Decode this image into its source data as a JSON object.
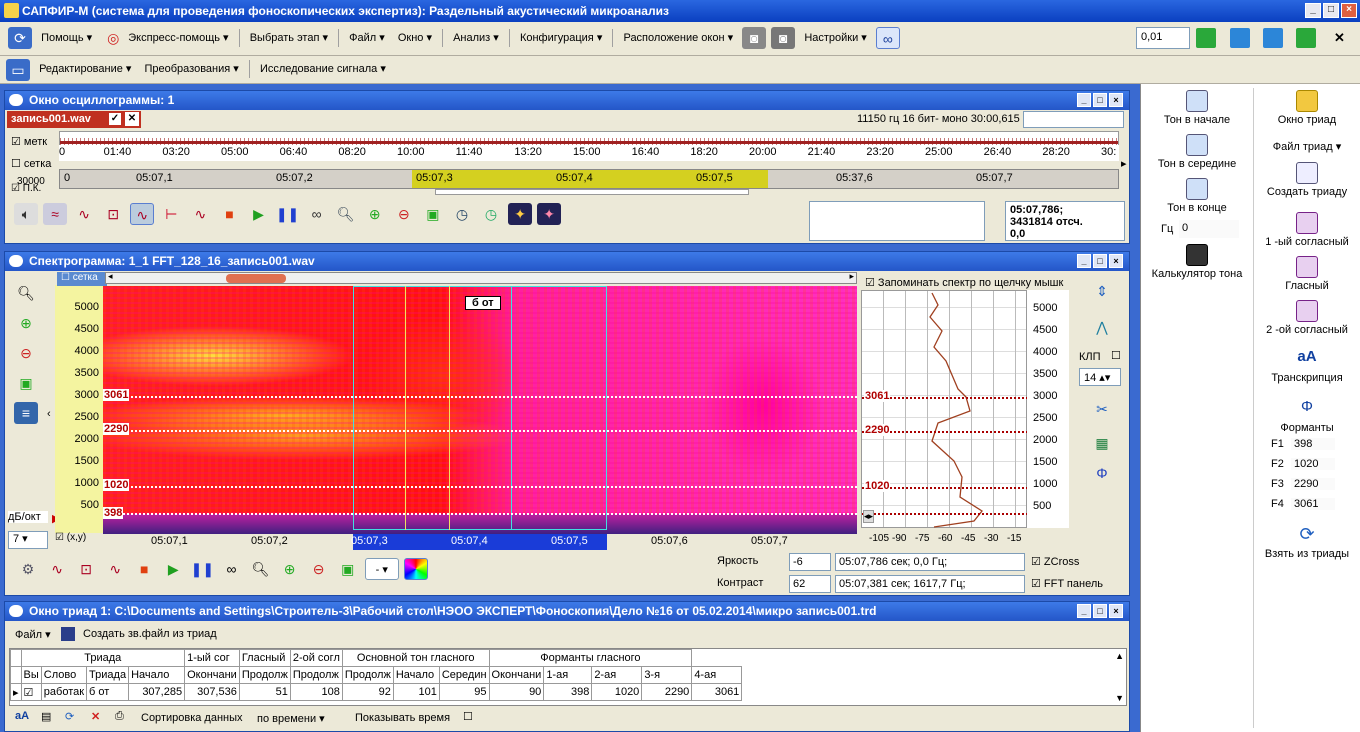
{
  "app": {
    "title": "САПФИР-М (система для проведения фоноскопических экспертиз): Раздельный акустический микроанализ"
  },
  "menu": {
    "help": "Помощь",
    "express": "Экспресс-помощь",
    "stage": "Выбрать этап",
    "file": "Файл",
    "window": "Окно",
    "analysis": "Анализ",
    "config": "Конфигурация",
    "layout": "Расположение окон",
    "settings": "Настройки",
    "step_value": "0,01"
  },
  "menu2": {
    "edit": "Редактирование",
    "transform": "Преобразования",
    "research": "Исследование сигнала"
  },
  "osc": {
    "title": "Окно осциллограммы: 1",
    "file": "запись001.wav",
    "info": "11150 гц 16 бит- моно 30:00,615",
    "marks": "метк",
    "grid": "сетка",
    "pk": "П.К.",
    "y30000": "30000",
    "ticks": [
      "0",
      "01:40",
      "03:20",
      "05:00",
      "06:40",
      "08:20",
      "10:00",
      "11:40",
      "13:20",
      "15:00",
      "16:40",
      "18:20",
      "20:00",
      "21:40",
      "23:20",
      "25:00",
      "26:40",
      "28:20",
      "30:"
    ],
    "zoom_ticks": [
      "0",
      "05:07,1",
      "05:07,2",
      "05:07,3",
      "05:07,4",
      "05:07,5",
      "05:37,6",
      "05:07,7"
    ],
    "pos_line1": "05:07,786;",
    "pos_line2": "3431814 отсч.",
    "pos_line3": "0,0"
  },
  "spec": {
    "title": "Спектрограмма: 1_1  FFT_128_16_запись001.wav",
    "grid": "сетка",
    "db_oct": "дБ/окт",
    "db_value": "7",
    "xy": "(x,y)",
    "yticks": [
      "5000",
      "4500",
      "4000",
      "3500",
      "3000",
      "2500",
      "2000",
      "1500",
      "1000",
      "500"
    ],
    "xticks": [
      "05:07,1",
      "05:07,2",
      "05:07,3",
      "05:07,4",
      "05:07,5",
      "05:07,6",
      "05:07,7"
    ],
    "formant_marks": [
      "3061",
      "2290",
      "1020",
      "398"
    ],
    "label_box": "б от",
    "remember": "Запоминать спектр по щелчку мышк",
    "spec_xticks": [
      "-105",
      "-90",
      "-75",
      "-60",
      "-45",
      "-30",
      "-15"
    ],
    "klp": "КЛП",
    "klp_val": "14",
    "brightness": "Яркость",
    "brightness_val": "-6",
    "contrast": "Контраст",
    "contrast_val": "62",
    "pos1": "05:07,786 сек; 0,0 Гц;",
    "pos2": "05:07,381 сек; 1617,7 Гц;",
    "zcross": "ZCross",
    "fft_panel": "FFT панель",
    "combo": "-"
  },
  "triad": {
    "title": "Окно триад 1: C:\\Documents and Settings\\Строитель-3\\Рабочий стол\\НЭОО ЭКСПЕРТ\\Фоноскопия\\Дело №16 от 05.02.2014\\микро запись001.trd",
    "file": "Файл",
    "create": "Создать зв.файл из триад",
    "groups": [
      "Триада",
      "1-ый сог",
      "Гласный",
      "2-ой согл",
      "Основной тон гласного",
      "Форманты гласного"
    ],
    "headers": [
      "Вы",
      "Слово",
      "Триада",
      "Начало",
      "Окончани",
      "Продолж",
      "Продолж",
      "Продолж",
      "Начало",
      "Середин",
      "Окончани",
      "1-ая",
      "2-ая",
      "3-я",
      "4-ая"
    ],
    "row": [
      "работак",
      "б от",
      "307,285",
      "307,536",
      "51",
      "108",
      "92",
      "101",
      "95",
      "90",
      "398",
      "1020",
      "2290",
      "3061"
    ],
    "sort": "Сортировка данных",
    "sort_val": "по времени",
    "show_time": "Показывать время"
  },
  "right": {
    "t1": "Тон в начале",
    "t2": "Тон в середине",
    "t3": "Тон в конце",
    "hz": "Гц",
    "hz_val": "0",
    "calc": "Калькулятор тона",
    "window": "Окно триад",
    "file": "Файл триад",
    "create": "Создать триаду",
    "c1": "1 -ый согласный",
    "vowel": "Гласный",
    "c2": "2 -ой согласный",
    "transcr": "Транскрипция",
    "formants": "Форманты",
    "f": [
      {
        "k": "F1",
        "v": "398"
      },
      {
        "k": "F2",
        "v": "1020"
      },
      {
        "k": "F3",
        "v": "2290"
      },
      {
        "k": "F4",
        "v": "3061"
      }
    ],
    "take": "Взять из триады"
  }
}
